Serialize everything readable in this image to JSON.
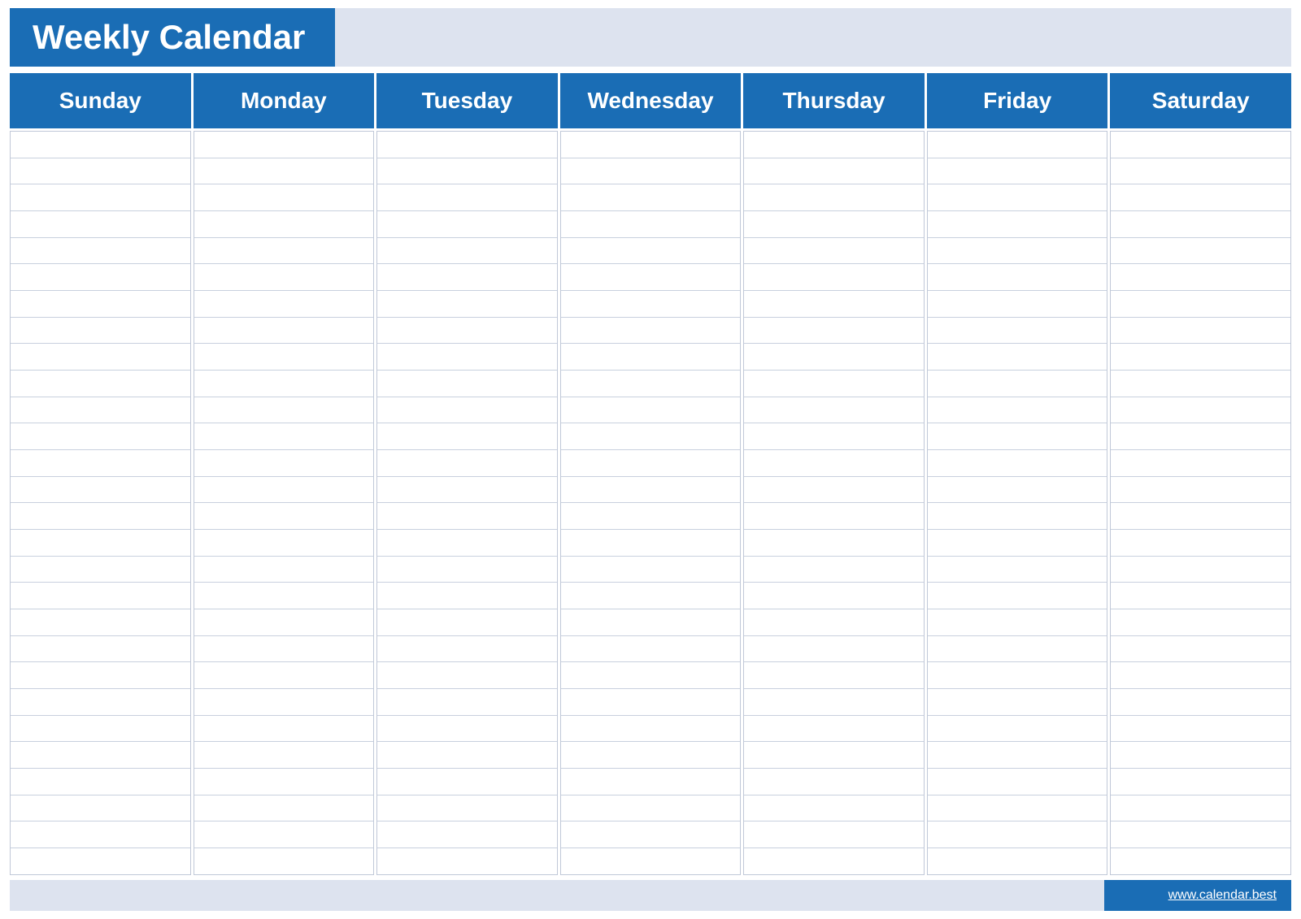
{
  "header": {
    "title": "Weekly Calendar",
    "accent_color": "#1a6db5",
    "bg_light": "#dde3ef"
  },
  "days": {
    "labels": [
      "Sunday",
      "Monday",
      "Tuesday",
      "Wednesday",
      "Thursday",
      "Friday",
      "Saturday"
    ]
  },
  "footer": {
    "link_text": "www.calendar.best"
  },
  "grid": {
    "lines_per_column": 28
  }
}
